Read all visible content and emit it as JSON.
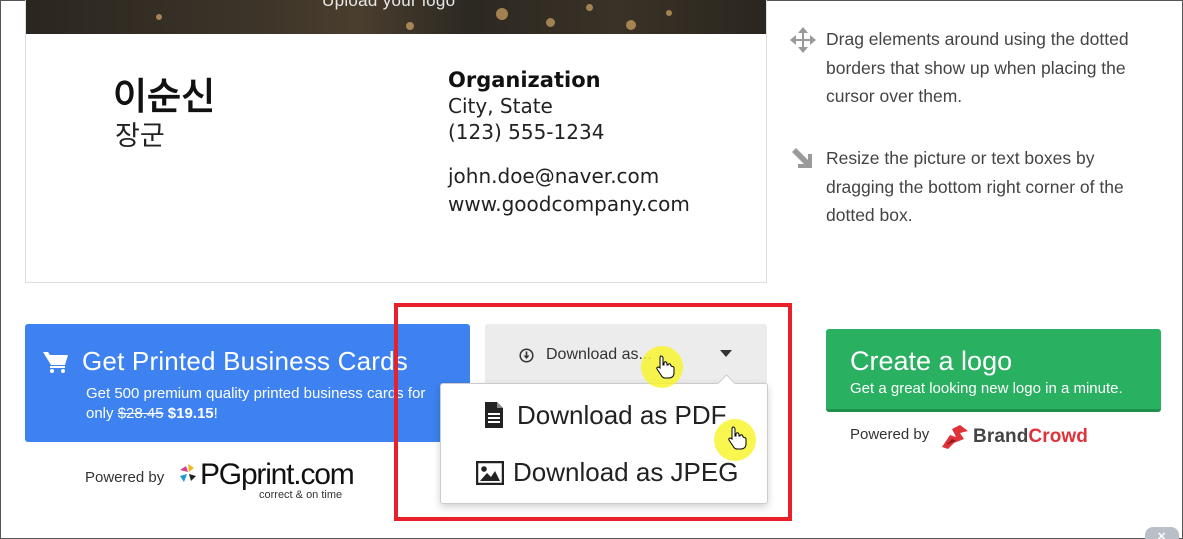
{
  "card": {
    "banner_text": "Upload your logo",
    "name": "이순신",
    "title": "장군",
    "organization": "Organization",
    "city_state": "City, State",
    "phone": "(123) 555-1234",
    "email": "john.doe@naver.com",
    "website": "www.goodcompany.com"
  },
  "tips": [
    {
      "icon": "move-arrows-icon",
      "text": "Drag elements around using the dotted borders that show up when placing the cursor over them."
    },
    {
      "icon": "resize-arrow-icon",
      "text": "Resize the picture or text boxes by dragging the bottom right corner of the dotted box."
    }
  ],
  "print": {
    "title": "Get Printed Business Cards",
    "subtitle_prefix": "Get 500 premium quality printed business cards for only",
    "old_price": "$28.45",
    "new_price": "$19.15",
    "suffix": "!",
    "powered_by": "Powered by",
    "logo_text": "PGprint.com",
    "logo_tagline": "correct & on time"
  },
  "download": {
    "button_label": "Download as...",
    "items": [
      {
        "icon": "document-icon",
        "label": "Download as PDF"
      },
      {
        "icon": "image-icon",
        "label": "Download as JPEG"
      }
    ]
  },
  "logo": {
    "title": "Create a logo",
    "subtitle": "Get a great looking new logo in a minute.",
    "powered_by": "Powered by",
    "brand_part1": "Brand",
    "brand_part2": "Crowd"
  },
  "colors": {
    "print_blue": "#3d82f0",
    "logo_green": "#29b060",
    "highlight_red": "#e8202a",
    "cursor_yellow": "#f6f428",
    "brandcrowd_red": "#e0323a"
  },
  "scroll_tab": {
    "label": "✕"
  }
}
